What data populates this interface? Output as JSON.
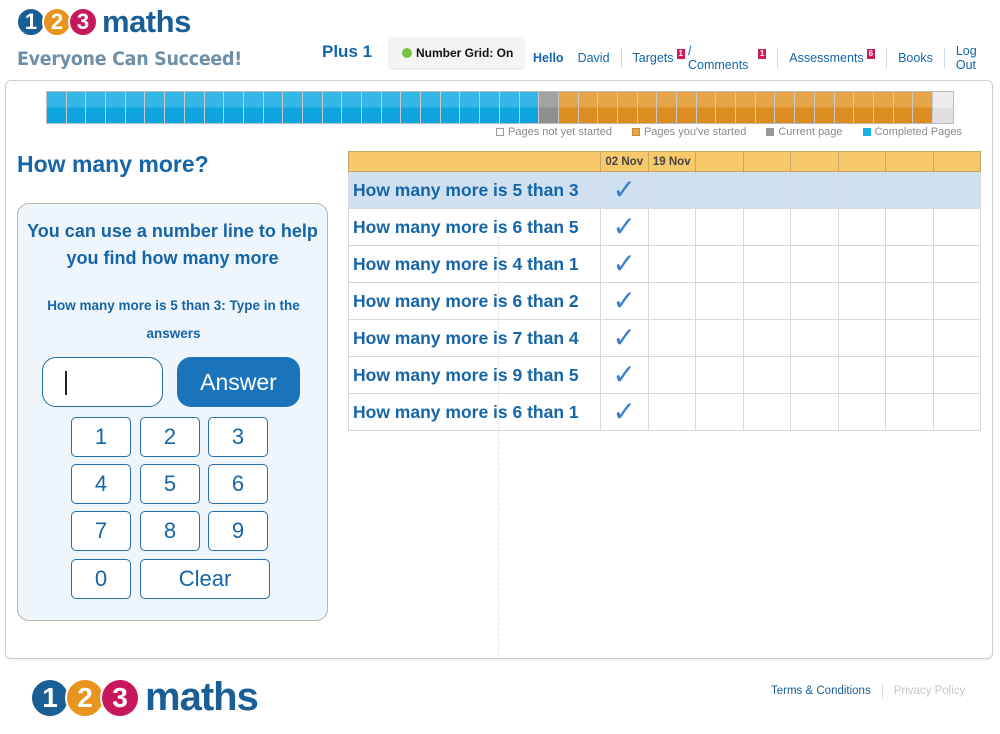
{
  "brand": {
    "logo_digits": [
      "1",
      "2",
      "3"
    ],
    "logo_word": "maths",
    "tagline": "Everyone Can Succeed!",
    "colors": {
      "blue": "#1a5e96",
      "orange": "#e8941e",
      "magenta": "#c8185d"
    }
  },
  "header": {
    "level": "Plus 1",
    "number_grid": {
      "label": "Number Grid: On",
      "status_color": "#7cc142"
    },
    "greeting": "Hello",
    "user_name": "David",
    "nav": [
      {
        "label": "Targets",
        "badge": "1"
      },
      {
        "label": "/ Comments",
        "badge": "1"
      },
      {
        "label": "Assessments",
        "badge": "6"
      },
      {
        "label": "Books"
      },
      {
        "label": "Log Out"
      }
    ]
  },
  "progress_bar": {
    "completed_pages": 25,
    "current_pages": 1,
    "started_pages": 19,
    "not_started_pages": 1,
    "colors": {
      "completed": "#0ea5df",
      "current": "#999999",
      "started": "#dc8d21",
      "not_started": "#e6e6e6"
    },
    "legend": [
      {
        "label": "Pages not yet started",
        "key": "not_started"
      },
      {
        "label": "Pages you've started",
        "key": "started"
      },
      {
        "label": "Current page",
        "key": "current"
      },
      {
        "label": "Completed Pages",
        "key": "completed"
      }
    ]
  },
  "page": {
    "title": "How many more?"
  },
  "question_panel": {
    "hint": "You can use a number line to help you find how many more",
    "prompt": "How many more is 5 than 3: Type in the answers",
    "answer_value": "",
    "answer_button": "Answer",
    "keypad": [
      "1",
      "2",
      "3",
      "4",
      "5",
      "6",
      "7",
      "8",
      "9",
      "0"
    ],
    "clear_button": "Clear"
  },
  "results_table": {
    "date_columns": [
      "02 Nov",
      "19 Nov",
      "",
      "",
      "",
      "",
      "",
      ""
    ],
    "check_glyph": "✓",
    "rows": [
      {
        "question": "How many more is 5 than 3",
        "results": [
          true,
          false,
          false,
          false,
          false,
          false,
          false,
          false
        ],
        "selected": true
      },
      {
        "question": "How many more is 6 than 5",
        "results": [
          true,
          false,
          false,
          false,
          false,
          false,
          false,
          false
        ],
        "selected": false
      },
      {
        "question": "How many more is 4 than 1",
        "results": [
          true,
          false,
          false,
          false,
          false,
          false,
          false,
          false
        ],
        "selected": false
      },
      {
        "question": "How many more is 6 than 2",
        "results": [
          true,
          false,
          false,
          false,
          false,
          false,
          false,
          false
        ],
        "selected": false
      },
      {
        "question": "How many more is 7 than 4",
        "results": [
          true,
          false,
          false,
          false,
          false,
          false,
          false,
          false
        ],
        "selected": false
      },
      {
        "question": "How many more is 9 than 5",
        "results": [
          true,
          false,
          false,
          false,
          false,
          false,
          false,
          false
        ],
        "selected": false
      },
      {
        "question": "How many more is 6 than 1",
        "results": [
          true,
          false,
          false,
          false,
          false,
          false,
          false,
          false
        ],
        "selected": false
      }
    ]
  },
  "footer": {
    "terms": "Terms & Conditions",
    "privacy": "Privacy Policy"
  }
}
